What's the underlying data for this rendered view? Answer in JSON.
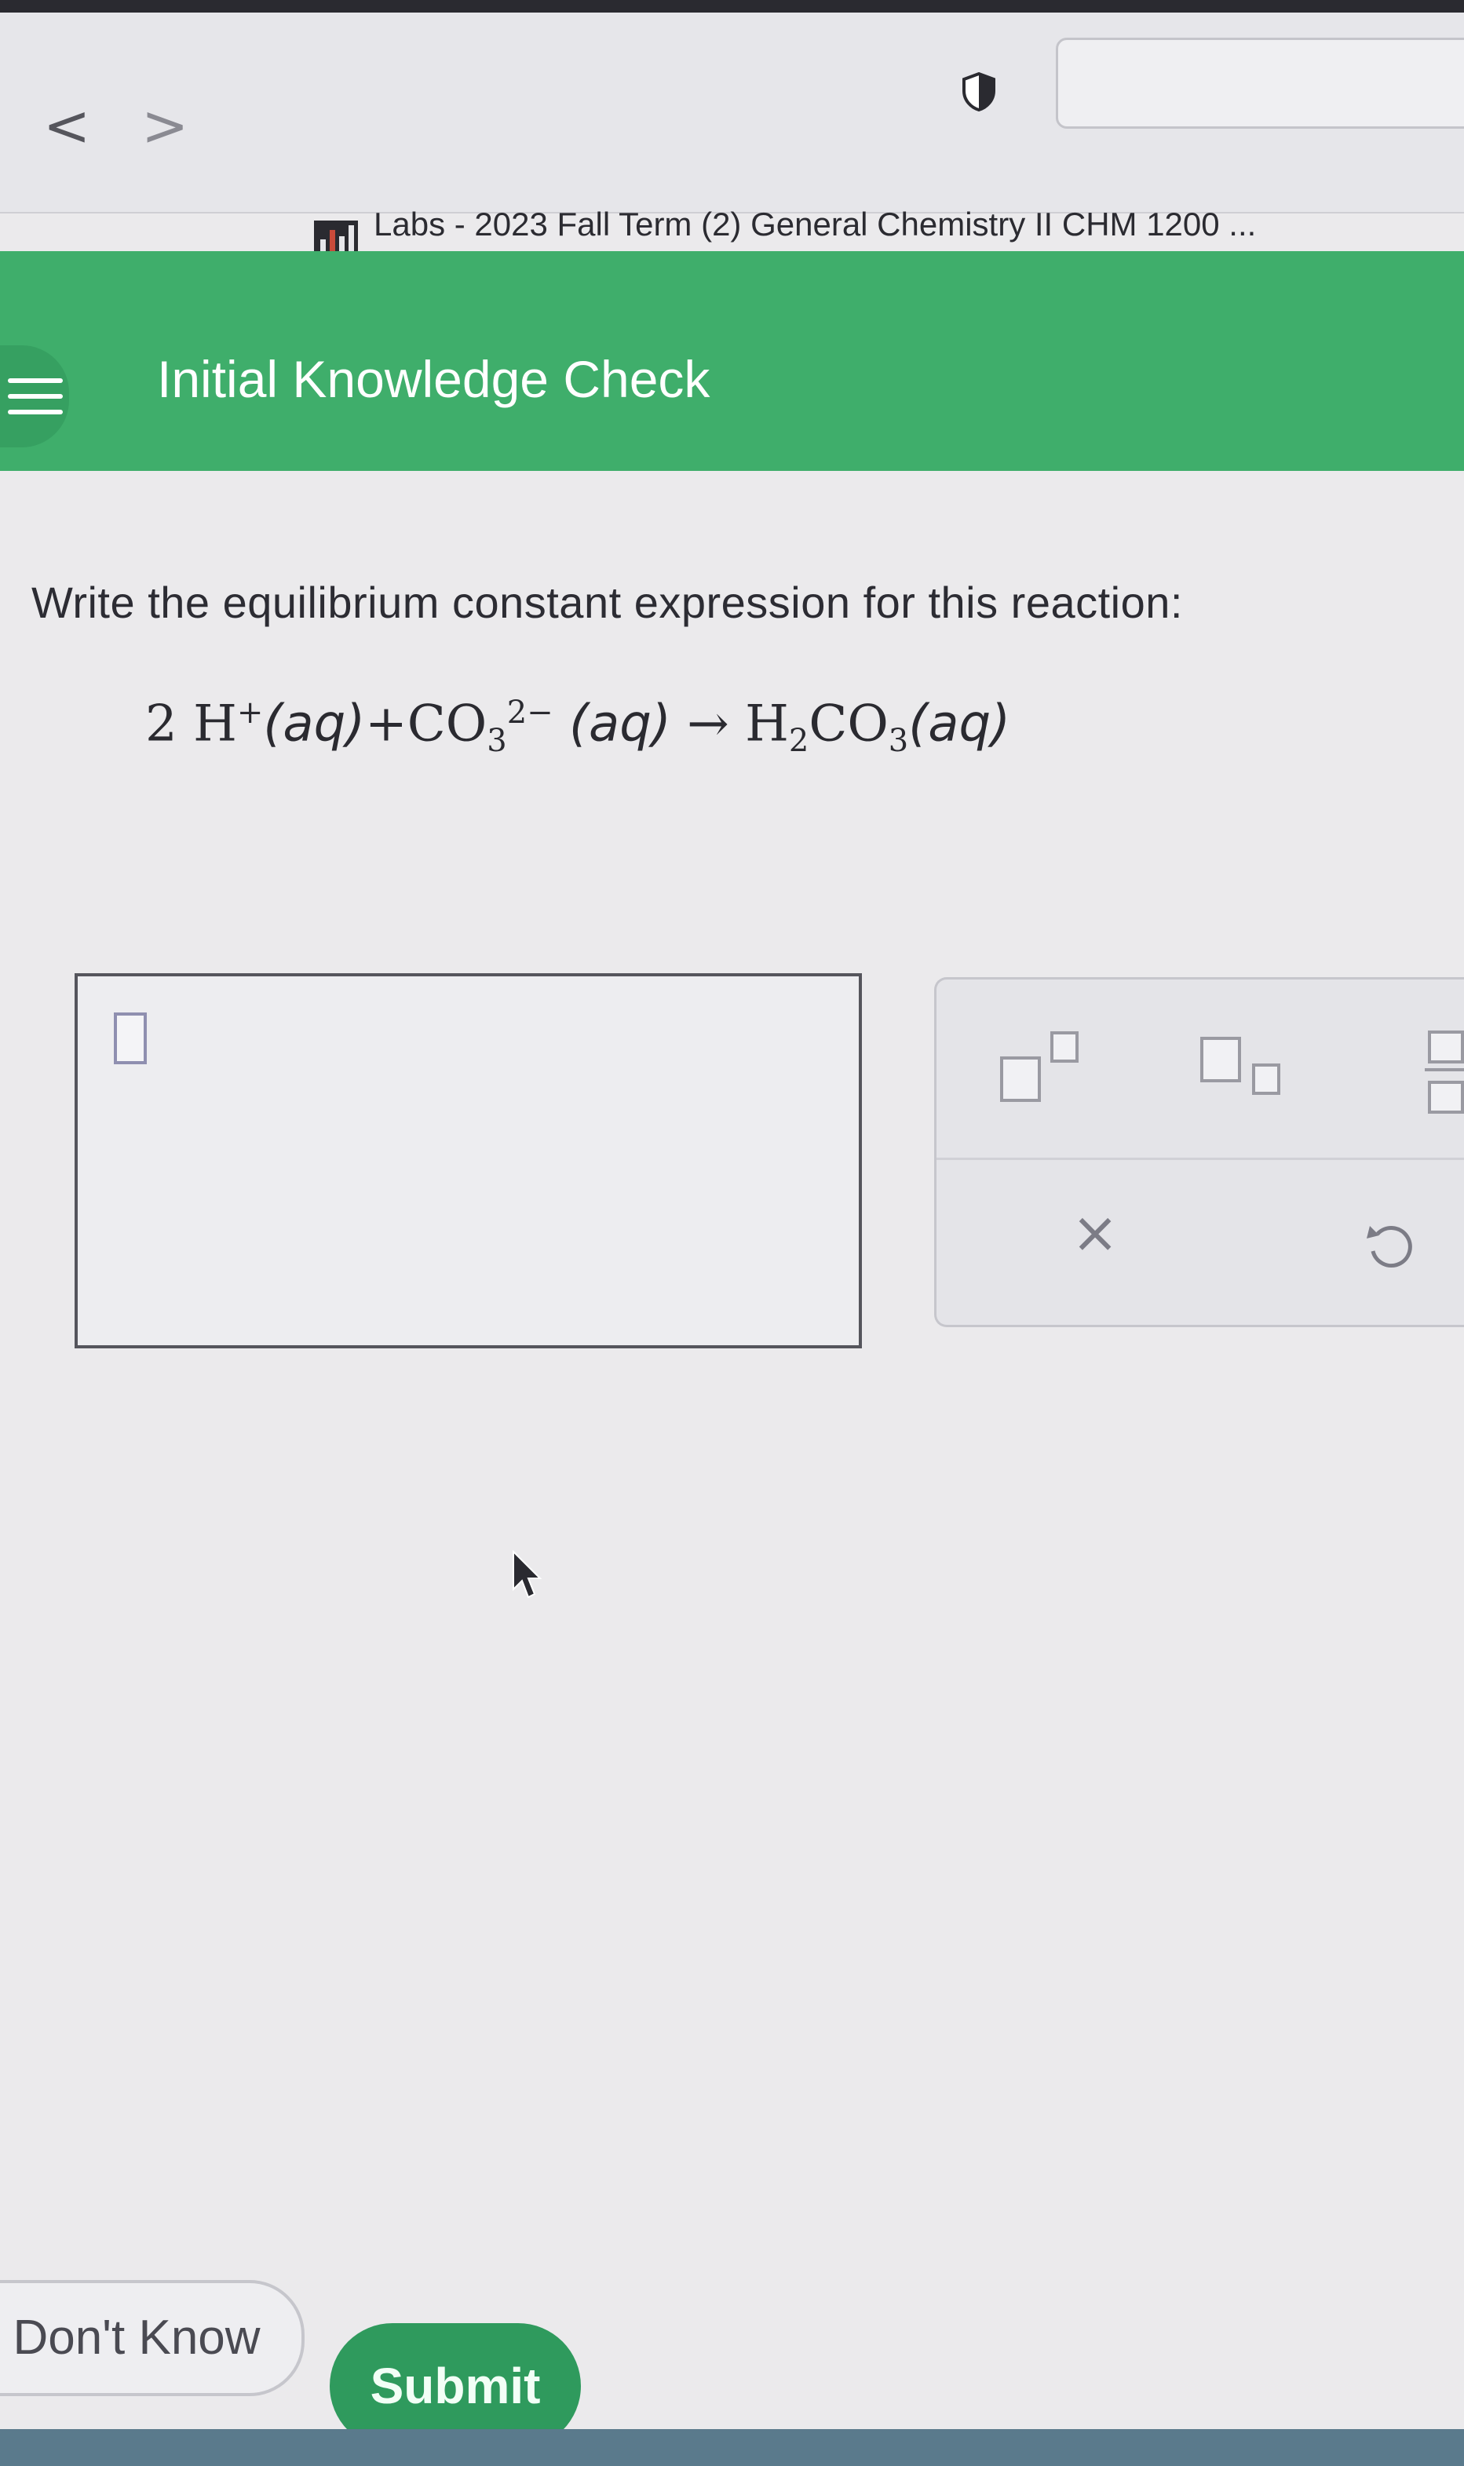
{
  "browser": {
    "back_glyph": "<",
    "forward_glyph": ">",
    "tab_title": "Labs - 2023 Fall Term (2) General Chemistry II CHM 1200 ..."
  },
  "header": {
    "title": "Initial Knowledge Check",
    "color": "#3fae6b"
  },
  "question": {
    "prompt": "Write the equilibrium constant expression for this reaction:",
    "equation": {
      "coef": "2",
      "h": "H",
      "h_charge": "+",
      "aq1": "(aq)",
      "plus": "+",
      "co": "CO",
      "co_sub": "3",
      "co_charge": "2−",
      "aq2": "(aq)",
      "arrow": "→",
      "h2": "H",
      "h2_sub": "2",
      "co3": "CO",
      "co3_sub": "3",
      "aq3": "(aq)"
    }
  },
  "toolbar": {
    "clear_glyph": "×"
  },
  "actions": {
    "dont_know_label": "Don't Know",
    "submit_label": "Submit",
    "submit_color": "#2f9a5d"
  }
}
